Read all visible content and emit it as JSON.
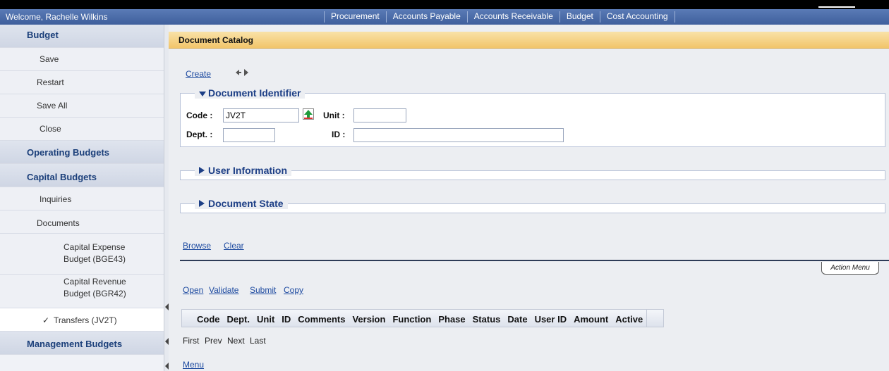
{
  "header": {
    "welcome": "Welcome, Rachelle Wilkins",
    "nav": [
      "Procurement",
      "Accounts Payable",
      "Accounts Receivable",
      "Budget",
      "Cost Accounting"
    ]
  },
  "sidebar": {
    "budget": "Budget",
    "save": "Save",
    "restart": "Restart",
    "save_all": "Save All",
    "close": "Close",
    "operating_budgets": "Operating Budgets",
    "capital_budgets": "Capital Budgets",
    "inquiries": "Inquiries",
    "documents": "Documents",
    "capital_expense_1": "Capital Expense",
    "capital_expense_2": "Budget (BGE43)",
    "capital_revenue_1": "Capital Revenue",
    "capital_revenue_2": "Budget (BGR42)",
    "transfers": "Transfers (JV2T)",
    "checkmark": "✓",
    "management_budgets": "Management Budgets"
  },
  "main": {
    "title": "Document Catalog",
    "create": "Create",
    "doc_identifier": "Document Identifier",
    "code_label": "Code :",
    "code_value": "JV2T",
    "unit_label": "Unit :",
    "unit_value": "",
    "dept_label": "Dept. :",
    "dept_value": "",
    "id_label": "ID :",
    "id_value": "",
    "user_information": "User Information",
    "document_state": "Document State",
    "browse": "Browse",
    "clear": "Clear",
    "action_menu": "Action Menu",
    "open": "Open",
    "validate": "Validate",
    "submit": "Submit",
    "copy": "Copy",
    "columns": [
      "Code",
      "Dept.",
      "Unit",
      "ID",
      "Comments",
      "Version",
      "Function",
      "Phase",
      "Status",
      "Date",
      "User ID",
      "Amount",
      "Active"
    ],
    "first": "First",
    "prev": "Prev",
    "next": "Next",
    "last": "Last",
    "menu": "Menu"
  },
  "colors": {
    "header": "#4a6aa8",
    "title_bar": "#f2c56a",
    "link": "#1d4aa0",
    "legend": "#1d3f86"
  }
}
